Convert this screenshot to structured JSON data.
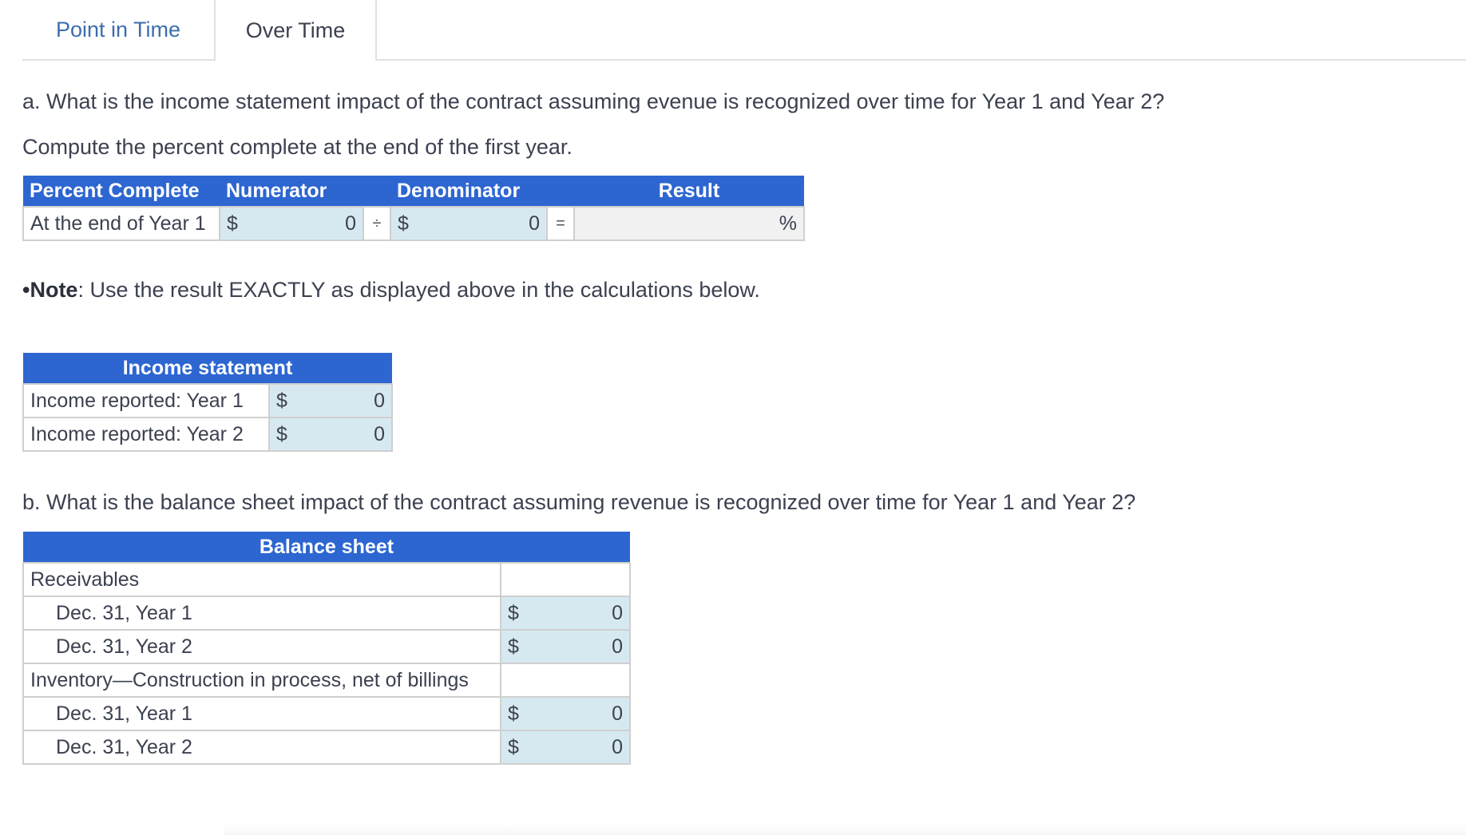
{
  "tabs": [
    {
      "label": "Point in Time",
      "active": false
    },
    {
      "label": "Over Time",
      "active": true
    }
  ],
  "part_a": {
    "question": "a. What is the income statement impact of the contract assuming evenue is recognized over time for Year 1 and Year 2?",
    "instruction": "Compute the percent complete at the end of the first year.",
    "percent_table": {
      "headers": [
        "Percent Complete",
        "Numerator",
        "Denominator",
        "Result"
      ],
      "row_label": "At the end of Year 1",
      "currency": "$",
      "numerator": "0",
      "divide_symbol": "÷",
      "denominator": "0",
      "equals_symbol": "=",
      "result": "",
      "result_unit": "%"
    },
    "note_bullet": "•",
    "note_bold": "Note",
    "note_text": ": Use the result EXACTLY as displayed above in the calculations below.",
    "income_table": {
      "header": "Income statement",
      "rows": [
        {
          "label": "Income reported: Year 1",
          "currency": "$",
          "value": "0"
        },
        {
          "label": "Income reported: Year 2",
          "currency": "$",
          "value": "0"
        }
      ]
    }
  },
  "part_b": {
    "question": "b. What is the balance sheet impact of the contract assuming revenue is recognized over time for Year 1 and Year 2?",
    "balance_table": {
      "header": "Balance sheet",
      "rows": [
        {
          "label": "Receivables",
          "section": true
        },
        {
          "label": "Dec. 31, Year 1",
          "currency": "$",
          "value": "0"
        },
        {
          "label": "Dec. 31, Year 2",
          "currency": "$",
          "value": "0"
        },
        {
          "label": "Inventory—Construction in process, net of billings",
          "section": true
        },
        {
          "label": "Dec. 31, Year 1",
          "currency": "$",
          "value": "0"
        },
        {
          "label": "Dec. 31, Year 2",
          "currency": "$",
          "value": "0"
        }
      ]
    }
  },
  "colors": {
    "header_blue": "#2d66d1",
    "input_bg": "#d7e9f0",
    "result_bg": "#f1f1f1",
    "tab_link": "#3b6eac"
  }
}
